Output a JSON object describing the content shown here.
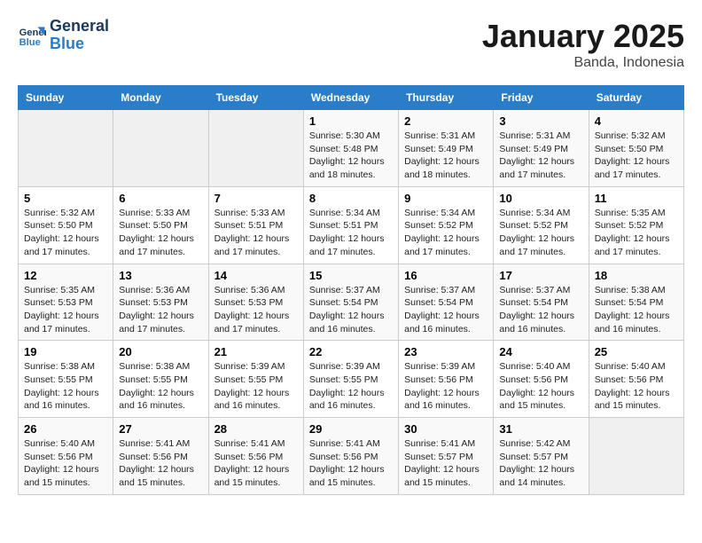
{
  "logo": {
    "line1": "General",
    "line2": "Blue"
  },
  "title": "January 2025",
  "subtitle": "Banda, Indonesia",
  "days_of_week": [
    "Sunday",
    "Monday",
    "Tuesday",
    "Wednesday",
    "Thursday",
    "Friday",
    "Saturday"
  ],
  "weeks": [
    [
      {
        "day": "",
        "sunrise": "",
        "sunset": "",
        "daylight": ""
      },
      {
        "day": "",
        "sunrise": "",
        "sunset": "",
        "daylight": ""
      },
      {
        "day": "",
        "sunrise": "",
        "sunset": "",
        "daylight": ""
      },
      {
        "day": "1",
        "sunrise": "Sunrise: 5:30 AM",
        "sunset": "Sunset: 5:48 PM",
        "daylight": "Daylight: 12 hours and 18 minutes."
      },
      {
        "day": "2",
        "sunrise": "Sunrise: 5:31 AM",
        "sunset": "Sunset: 5:49 PM",
        "daylight": "Daylight: 12 hours and 18 minutes."
      },
      {
        "day": "3",
        "sunrise": "Sunrise: 5:31 AM",
        "sunset": "Sunset: 5:49 PM",
        "daylight": "Daylight: 12 hours and 17 minutes."
      },
      {
        "day": "4",
        "sunrise": "Sunrise: 5:32 AM",
        "sunset": "Sunset: 5:50 PM",
        "daylight": "Daylight: 12 hours and 17 minutes."
      }
    ],
    [
      {
        "day": "5",
        "sunrise": "Sunrise: 5:32 AM",
        "sunset": "Sunset: 5:50 PM",
        "daylight": "Daylight: 12 hours and 17 minutes."
      },
      {
        "day": "6",
        "sunrise": "Sunrise: 5:33 AM",
        "sunset": "Sunset: 5:50 PM",
        "daylight": "Daylight: 12 hours and 17 minutes."
      },
      {
        "day": "7",
        "sunrise": "Sunrise: 5:33 AM",
        "sunset": "Sunset: 5:51 PM",
        "daylight": "Daylight: 12 hours and 17 minutes."
      },
      {
        "day": "8",
        "sunrise": "Sunrise: 5:34 AM",
        "sunset": "Sunset: 5:51 PM",
        "daylight": "Daylight: 12 hours and 17 minutes."
      },
      {
        "day": "9",
        "sunrise": "Sunrise: 5:34 AM",
        "sunset": "Sunset: 5:52 PM",
        "daylight": "Daylight: 12 hours and 17 minutes."
      },
      {
        "day": "10",
        "sunrise": "Sunrise: 5:34 AM",
        "sunset": "Sunset: 5:52 PM",
        "daylight": "Daylight: 12 hours and 17 minutes."
      },
      {
        "day": "11",
        "sunrise": "Sunrise: 5:35 AM",
        "sunset": "Sunset: 5:52 PM",
        "daylight": "Daylight: 12 hours and 17 minutes."
      }
    ],
    [
      {
        "day": "12",
        "sunrise": "Sunrise: 5:35 AM",
        "sunset": "Sunset: 5:53 PM",
        "daylight": "Daylight: 12 hours and 17 minutes."
      },
      {
        "day": "13",
        "sunrise": "Sunrise: 5:36 AM",
        "sunset": "Sunset: 5:53 PM",
        "daylight": "Daylight: 12 hours and 17 minutes."
      },
      {
        "day": "14",
        "sunrise": "Sunrise: 5:36 AM",
        "sunset": "Sunset: 5:53 PM",
        "daylight": "Daylight: 12 hours and 17 minutes."
      },
      {
        "day": "15",
        "sunrise": "Sunrise: 5:37 AM",
        "sunset": "Sunset: 5:54 PM",
        "daylight": "Daylight: 12 hours and 16 minutes."
      },
      {
        "day": "16",
        "sunrise": "Sunrise: 5:37 AM",
        "sunset": "Sunset: 5:54 PM",
        "daylight": "Daylight: 12 hours and 16 minutes."
      },
      {
        "day": "17",
        "sunrise": "Sunrise: 5:37 AM",
        "sunset": "Sunset: 5:54 PM",
        "daylight": "Daylight: 12 hours and 16 minutes."
      },
      {
        "day": "18",
        "sunrise": "Sunrise: 5:38 AM",
        "sunset": "Sunset: 5:54 PM",
        "daylight": "Daylight: 12 hours and 16 minutes."
      }
    ],
    [
      {
        "day": "19",
        "sunrise": "Sunrise: 5:38 AM",
        "sunset": "Sunset: 5:55 PM",
        "daylight": "Daylight: 12 hours and 16 minutes."
      },
      {
        "day": "20",
        "sunrise": "Sunrise: 5:38 AM",
        "sunset": "Sunset: 5:55 PM",
        "daylight": "Daylight: 12 hours and 16 minutes."
      },
      {
        "day": "21",
        "sunrise": "Sunrise: 5:39 AM",
        "sunset": "Sunset: 5:55 PM",
        "daylight": "Daylight: 12 hours and 16 minutes."
      },
      {
        "day": "22",
        "sunrise": "Sunrise: 5:39 AM",
        "sunset": "Sunset: 5:55 PM",
        "daylight": "Daylight: 12 hours and 16 minutes."
      },
      {
        "day": "23",
        "sunrise": "Sunrise: 5:39 AM",
        "sunset": "Sunset: 5:56 PM",
        "daylight": "Daylight: 12 hours and 16 minutes."
      },
      {
        "day": "24",
        "sunrise": "Sunrise: 5:40 AM",
        "sunset": "Sunset: 5:56 PM",
        "daylight": "Daylight: 12 hours and 15 minutes."
      },
      {
        "day": "25",
        "sunrise": "Sunrise: 5:40 AM",
        "sunset": "Sunset: 5:56 PM",
        "daylight": "Daylight: 12 hours and 15 minutes."
      }
    ],
    [
      {
        "day": "26",
        "sunrise": "Sunrise: 5:40 AM",
        "sunset": "Sunset: 5:56 PM",
        "daylight": "Daylight: 12 hours and 15 minutes."
      },
      {
        "day": "27",
        "sunrise": "Sunrise: 5:41 AM",
        "sunset": "Sunset: 5:56 PM",
        "daylight": "Daylight: 12 hours and 15 minutes."
      },
      {
        "day": "28",
        "sunrise": "Sunrise: 5:41 AM",
        "sunset": "Sunset: 5:56 PM",
        "daylight": "Daylight: 12 hours and 15 minutes."
      },
      {
        "day": "29",
        "sunrise": "Sunrise: 5:41 AM",
        "sunset": "Sunset: 5:56 PM",
        "daylight": "Daylight: 12 hours and 15 minutes."
      },
      {
        "day": "30",
        "sunrise": "Sunrise: 5:41 AM",
        "sunset": "Sunset: 5:57 PM",
        "daylight": "Daylight: 12 hours and 15 minutes."
      },
      {
        "day": "31",
        "sunrise": "Sunrise: 5:42 AM",
        "sunset": "Sunset: 5:57 PM",
        "daylight": "Daylight: 12 hours and 14 minutes."
      },
      {
        "day": "",
        "sunrise": "",
        "sunset": "",
        "daylight": ""
      }
    ]
  ]
}
